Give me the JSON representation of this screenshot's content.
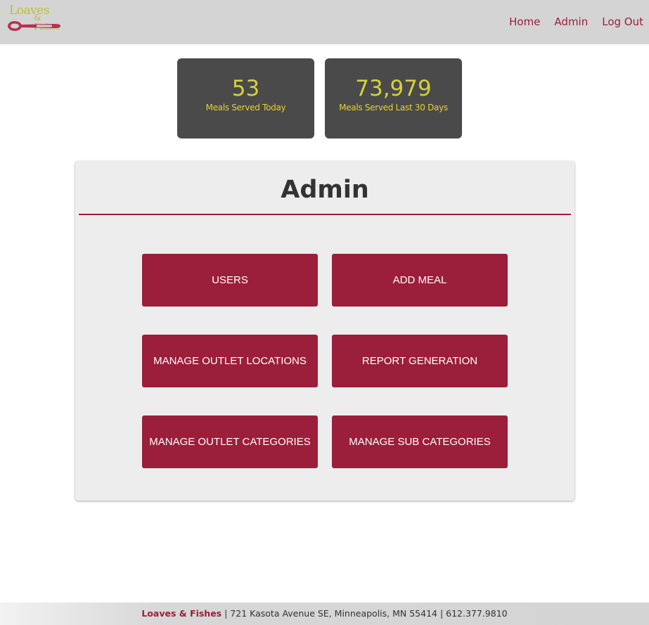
{
  "header": {
    "logo": {
      "line1": "Loaves",
      "line2": "& Fishes"
    },
    "nav": [
      "Home",
      "Admin",
      "Log Out"
    ]
  },
  "stats": [
    {
      "value": "53",
      "label": "Meals Served Today"
    },
    {
      "value": "73,979",
      "label": "Meals Served Last 30 Days"
    }
  ],
  "admin": {
    "title": "Admin",
    "buttons": [
      "USERS",
      "ADD MEAL",
      "MANAGE OUTLET LOCATIONS",
      "REPORT GENERATION",
      "MANAGE OUTLET CATEGORIES",
      "MANAGE SUB CATEGORIES"
    ]
  },
  "footer": {
    "brand": "Loaves & Fishes",
    "separator1": " | ",
    "address": "721 Kasota Avenue SE, Minneapolis, MN 55414",
    "separator2": " | ",
    "phone": "612.377.9810"
  },
  "colors": {
    "brand": "#9b1e3a",
    "accent": "#d4d13e",
    "header_bg": "#d4d4d4",
    "card_bg": "#4a4a4a",
    "panel_bg": "#ededed"
  }
}
